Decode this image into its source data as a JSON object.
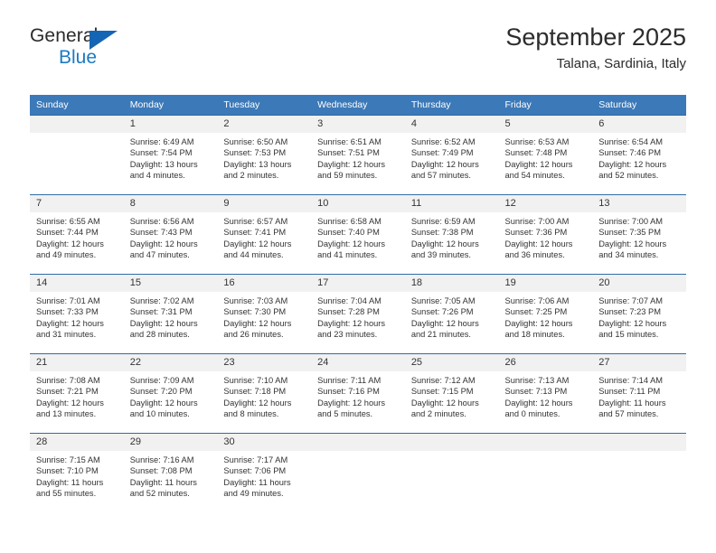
{
  "brand": {
    "name_top": "General",
    "name_bottom": "Blue",
    "triangle_color": "#1565b5",
    "text_color": "#1a7ac4"
  },
  "header": {
    "title": "September 2025",
    "subtitle": "Talana, Sardinia, Italy",
    "header_bg": "#3c79b8",
    "row_border": "#2e6da8",
    "daynum_bg": "#f1f1f1"
  },
  "weekday_headers": [
    "Sunday",
    "Monday",
    "Tuesday",
    "Wednesday",
    "Thursday",
    "Friday",
    "Saturday"
  ],
  "weeks": [
    [
      {
        "day": "",
        "sunrise": "",
        "sunset": "",
        "daylight": ""
      },
      {
        "day": "1",
        "sunrise": "Sunrise: 6:49 AM",
        "sunset": "Sunset: 7:54 PM",
        "daylight": "Daylight: 13 hours and 4 minutes."
      },
      {
        "day": "2",
        "sunrise": "Sunrise: 6:50 AM",
        "sunset": "Sunset: 7:53 PM",
        "daylight": "Daylight: 13 hours and 2 minutes."
      },
      {
        "day": "3",
        "sunrise": "Sunrise: 6:51 AM",
        "sunset": "Sunset: 7:51 PM",
        "daylight": "Daylight: 12 hours and 59 minutes."
      },
      {
        "day": "4",
        "sunrise": "Sunrise: 6:52 AM",
        "sunset": "Sunset: 7:49 PM",
        "daylight": "Daylight: 12 hours and 57 minutes."
      },
      {
        "day": "5",
        "sunrise": "Sunrise: 6:53 AM",
        "sunset": "Sunset: 7:48 PM",
        "daylight": "Daylight: 12 hours and 54 minutes."
      },
      {
        "day": "6",
        "sunrise": "Sunrise: 6:54 AM",
        "sunset": "Sunset: 7:46 PM",
        "daylight": "Daylight: 12 hours and 52 minutes."
      }
    ],
    [
      {
        "day": "7",
        "sunrise": "Sunrise: 6:55 AM",
        "sunset": "Sunset: 7:44 PM",
        "daylight": "Daylight: 12 hours and 49 minutes."
      },
      {
        "day": "8",
        "sunrise": "Sunrise: 6:56 AM",
        "sunset": "Sunset: 7:43 PM",
        "daylight": "Daylight: 12 hours and 47 minutes."
      },
      {
        "day": "9",
        "sunrise": "Sunrise: 6:57 AM",
        "sunset": "Sunset: 7:41 PM",
        "daylight": "Daylight: 12 hours and 44 minutes."
      },
      {
        "day": "10",
        "sunrise": "Sunrise: 6:58 AM",
        "sunset": "Sunset: 7:40 PM",
        "daylight": "Daylight: 12 hours and 41 minutes."
      },
      {
        "day": "11",
        "sunrise": "Sunrise: 6:59 AM",
        "sunset": "Sunset: 7:38 PM",
        "daylight": "Daylight: 12 hours and 39 minutes."
      },
      {
        "day": "12",
        "sunrise": "Sunrise: 7:00 AM",
        "sunset": "Sunset: 7:36 PM",
        "daylight": "Daylight: 12 hours and 36 minutes."
      },
      {
        "day": "13",
        "sunrise": "Sunrise: 7:00 AM",
        "sunset": "Sunset: 7:35 PM",
        "daylight": "Daylight: 12 hours and 34 minutes."
      }
    ],
    [
      {
        "day": "14",
        "sunrise": "Sunrise: 7:01 AM",
        "sunset": "Sunset: 7:33 PM",
        "daylight": "Daylight: 12 hours and 31 minutes."
      },
      {
        "day": "15",
        "sunrise": "Sunrise: 7:02 AM",
        "sunset": "Sunset: 7:31 PM",
        "daylight": "Daylight: 12 hours and 28 minutes."
      },
      {
        "day": "16",
        "sunrise": "Sunrise: 7:03 AM",
        "sunset": "Sunset: 7:30 PM",
        "daylight": "Daylight: 12 hours and 26 minutes."
      },
      {
        "day": "17",
        "sunrise": "Sunrise: 7:04 AM",
        "sunset": "Sunset: 7:28 PM",
        "daylight": "Daylight: 12 hours and 23 minutes."
      },
      {
        "day": "18",
        "sunrise": "Sunrise: 7:05 AM",
        "sunset": "Sunset: 7:26 PM",
        "daylight": "Daylight: 12 hours and 21 minutes."
      },
      {
        "day": "19",
        "sunrise": "Sunrise: 7:06 AM",
        "sunset": "Sunset: 7:25 PM",
        "daylight": "Daylight: 12 hours and 18 minutes."
      },
      {
        "day": "20",
        "sunrise": "Sunrise: 7:07 AM",
        "sunset": "Sunset: 7:23 PM",
        "daylight": "Daylight: 12 hours and 15 minutes."
      }
    ],
    [
      {
        "day": "21",
        "sunrise": "Sunrise: 7:08 AM",
        "sunset": "Sunset: 7:21 PM",
        "daylight": "Daylight: 12 hours and 13 minutes."
      },
      {
        "day": "22",
        "sunrise": "Sunrise: 7:09 AM",
        "sunset": "Sunset: 7:20 PM",
        "daylight": "Daylight: 12 hours and 10 minutes."
      },
      {
        "day": "23",
        "sunrise": "Sunrise: 7:10 AM",
        "sunset": "Sunset: 7:18 PM",
        "daylight": "Daylight: 12 hours and 8 minutes."
      },
      {
        "day": "24",
        "sunrise": "Sunrise: 7:11 AM",
        "sunset": "Sunset: 7:16 PM",
        "daylight": "Daylight: 12 hours and 5 minutes."
      },
      {
        "day": "25",
        "sunrise": "Sunrise: 7:12 AM",
        "sunset": "Sunset: 7:15 PM",
        "daylight": "Daylight: 12 hours and 2 minutes."
      },
      {
        "day": "26",
        "sunrise": "Sunrise: 7:13 AM",
        "sunset": "Sunset: 7:13 PM",
        "daylight": "Daylight: 12 hours and 0 minutes."
      },
      {
        "day": "27",
        "sunrise": "Sunrise: 7:14 AM",
        "sunset": "Sunset: 7:11 PM",
        "daylight": "Daylight: 11 hours and 57 minutes."
      }
    ],
    [
      {
        "day": "28",
        "sunrise": "Sunrise: 7:15 AM",
        "sunset": "Sunset: 7:10 PM",
        "daylight": "Daylight: 11 hours and 55 minutes."
      },
      {
        "day": "29",
        "sunrise": "Sunrise: 7:16 AM",
        "sunset": "Sunset: 7:08 PM",
        "daylight": "Daylight: 11 hours and 52 minutes."
      },
      {
        "day": "30",
        "sunrise": "Sunrise: 7:17 AM",
        "sunset": "Sunset: 7:06 PM",
        "daylight": "Daylight: 11 hours and 49 minutes."
      },
      {
        "day": "",
        "sunrise": "",
        "sunset": "",
        "daylight": ""
      },
      {
        "day": "",
        "sunrise": "",
        "sunset": "",
        "daylight": ""
      },
      {
        "day": "",
        "sunrise": "",
        "sunset": "",
        "daylight": ""
      },
      {
        "day": "",
        "sunrise": "",
        "sunset": "",
        "daylight": ""
      }
    ]
  ]
}
